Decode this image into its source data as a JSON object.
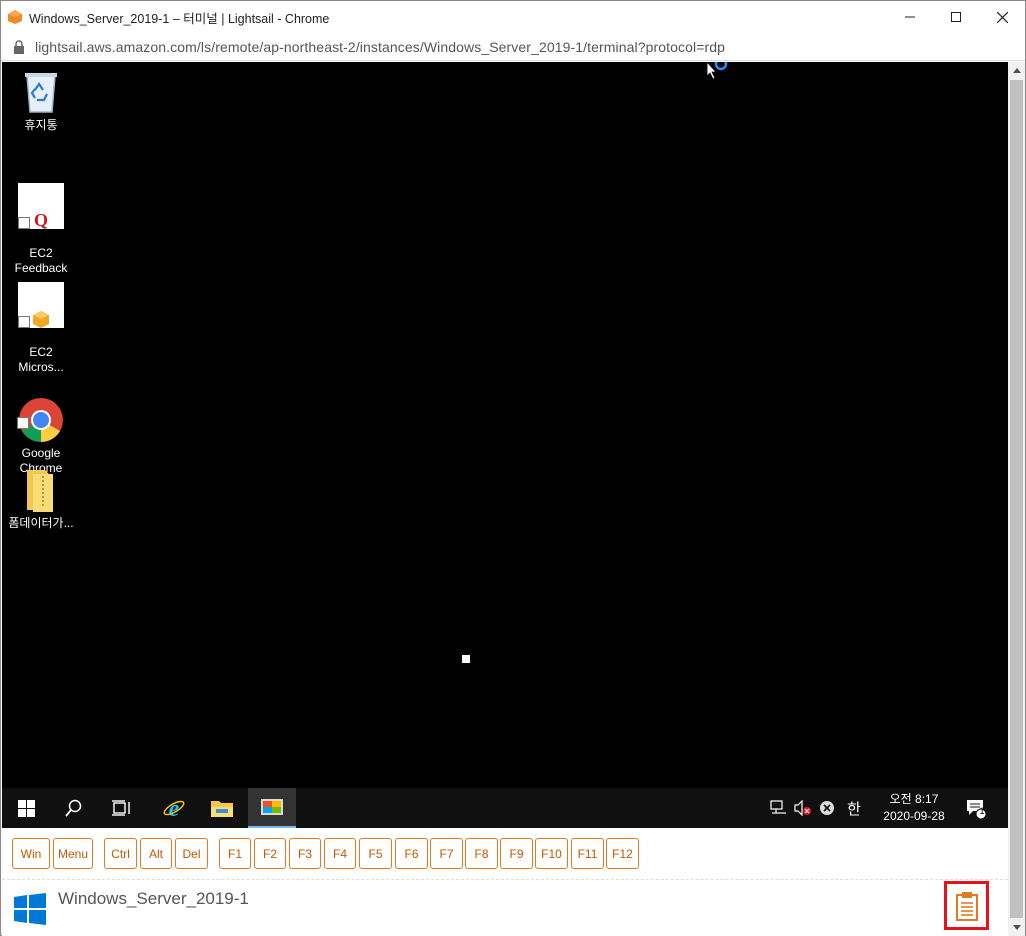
{
  "browser": {
    "title": "Windows_Server_2019-1 – 터미널 | Lightsail - Chrome",
    "url": "lightsail.aws.amazon.com/ls/remote/ap-northeast-2/instances/Windows_Server_2019-1/terminal?protocol=rdp"
  },
  "desktop": {
    "icons": [
      {
        "label": "휴지통",
        "icon": "recycle-bin-icon"
      },
      {
        "label": "EC2\nFeedback",
        "icon": "ec2-feedback-icon"
      },
      {
        "label": "EC2\nMicros...",
        "icon": "ec2-microsoft-icon"
      },
      {
        "label": "Google\nChrome",
        "icon": "chrome-icon"
      },
      {
        "label": "폼데이터가...",
        "icon": "folder-icon"
      }
    ]
  },
  "taskbar": {
    "clock_time": "오전 8:17",
    "clock_date": "2020-09-28",
    "ime": "한",
    "notification_count": "1"
  },
  "keys": [
    "Win",
    "Menu",
    "Ctrl",
    "Alt",
    "Del",
    "F1",
    "F2",
    "F3",
    "F4",
    "F5",
    "F6",
    "F7",
    "F8",
    "F9",
    "F10",
    "F11",
    "F12"
  ],
  "instance": {
    "name": "Windows_Server_2019-1"
  },
  "colors": {
    "accent": "#e07b1f",
    "highlight": "#e8101a",
    "desktop_bg": "#000000",
    "taskbar_bg": "#101010"
  }
}
